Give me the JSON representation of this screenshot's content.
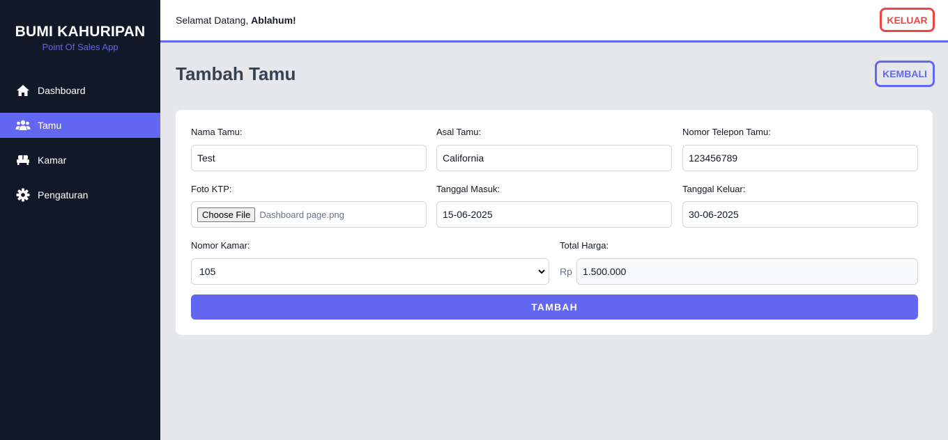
{
  "brand": {
    "title": "BUMI KAHURIPAN",
    "subtitle": "Point Of Sales App"
  },
  "nav": {
    "items": [
      {
        "label": "Dashboard",
        "icon": "home-icon",
        "active": false
      },
      {
        "label": "Tamu",
        "icon": "users-icon",
        "active": true
      },
      {
        "label": "Kamar",
        "icon": "bed-icon",
        "active": false
      },
      {
        "label": "Pengaturan",
        "icon": "gear-icon",
        "active": false
      }
    ]
  },
  "topbar": {
    "greeting": "Selamat Datang, ",
    "username": "Ablahum!",
    "logout_label": "KELUAR"
  },
  "page": {
    "title": "Tambah Tamu",
    "back_label": "KEMBALI"
  },
  "form": {
    "nama_label": "Nama Tamu:",
    "nama_value": "Test",
    "asal_label": "Asal Tamu:",
    "asal_value": "California",
    "telepon_label": "Nomor Telepon Tamu:",
    "telepon_value": "123456789",
    "ktp_label": "Foto KTP:",
    "ktp_button": "Choose File",
    "ktp_file": "Dashboard page.png",
    "masuk_label": "Tanggal Masuk:",
    "masuk_value": "15-06-2025",
    "keluar_label": "Tanggal Keluar:",
    "keluar_value": "30-06-2025",
    "kamar_label": "Nomor Kamar:",
    "kamar_value": "105",
    "harga_label": "Total Harga:",
    "harga_prefix": "Rp",
    "harga_value": "1.500.000",
    "submit_label": "TAMBAH"
  },
  "colors": {
    "sidebar": "#111827",
    "accent": "#6366f1",
    "danger": "#ef4444",
    "background": "#e5e7eb"
  }
}
